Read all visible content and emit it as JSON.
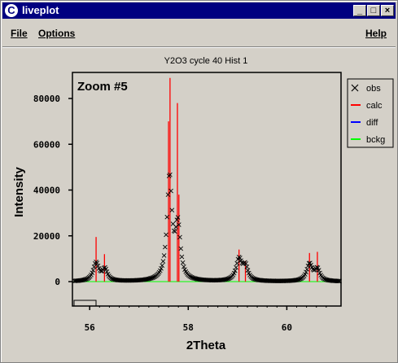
{
  "window": {
    "title": "liveplot",
    "app_icon": "C",
    "minimize_glyph": "_",
    "maximize_glyph": "□",
    "close_glyph": "×"
  },
  "menu": {
    "file_label": "File",
    "options_label": "Options",
    "help_label": "Help"
  },
  "colors": {
    "obs": "#000000",
    "calc": "#ff0000",
    "diff": "#0000ff",
    "bckg": "#00ff00"
  },
  "chart_data": {
    "type": "line",
    "title": "Y2O3 cycle 40 Hist 1",
    "annotation": "Zoom #5",
    "xlabel": "2Theta",
    "ylabel": "Intensity",
    "xlim": [
      55.65,
      61.1
    ],
    "ylim": [
      -10000,
      90000
    ],
    "x_ticks": [
      56,
      58,
      60
    ],
    "x_tick_labels": [
      "56",
      "58",
      "60"
    ],
    "y_ticks": [
      0,
      20000,
      40000,
      60000,
      80000
    ],
    "y_tick_labels": [
      "0",
      "20000",
      "40000",
      "60000",
      "80000"
    ],
    "legend_position": "right",
    "legend": [
      {
        "name": "obs",
        "marker": "x"
      },
      {
        "name": "calc",
        "marker": "line"
      },
      {
        "name": "diff",
        "marker": "line"
      },
      {
        "name": "bckg",
        "marker": "line"
      }
    ],
    "background_level": 0,
    "reflections": [
      {
        "x": 56.13,
        "calc_peak": 19500
      },
      {
        "x": 56.3,
        "calc_peak": 12000
      },
      {
        "x": 57.6,
        "calc_peak": 70000
      },
      {
        "x": 57.63,
        "calc_peak": 89000
      },
      {
        "x": 57.78,
        "calc_peak": 78000
      },
      {
        "x": 57.81,
        "calc_peak": 38000
      },
      {
        "x": 59.03,
        "calc_peak": 14000
      },
      {
        "x": 59.16,
        "calc_peak": 9000
      },
      {
        "x": 60.46,
        "calc_peak": 12500
      },
      {
        "x": 60.62,
        "calc_peak": 13000
      }
    ],
    "obs_peaks": [
      {
        "center": 56.13,
        "height": 8000,
        "width": 0.07
      },
      {
        "center": 56.31,
        "height": 5000,
        "width": 0.06
      },
      {
        "center": 57.62,
        "height": 45000,
        "width": 0.06
      },
      {
        "center": 57.79,
        "height": 23000,
        "width": 0.06
      },
      {
        "center": 59.03,
        "height": 9500,
        "width": 0.07
      },
      {
        "center": 59.16,
        "height": 6000,
        "width": 0.06
      },
      {
        "center": 60.46,
        "height": 7500,
        "width": 0.07
      },
      {
        "center": 60.62,
        "height": 5000,
        "width": 0.06
      }
    ],
    "obs_step": 0.02
  }
}
